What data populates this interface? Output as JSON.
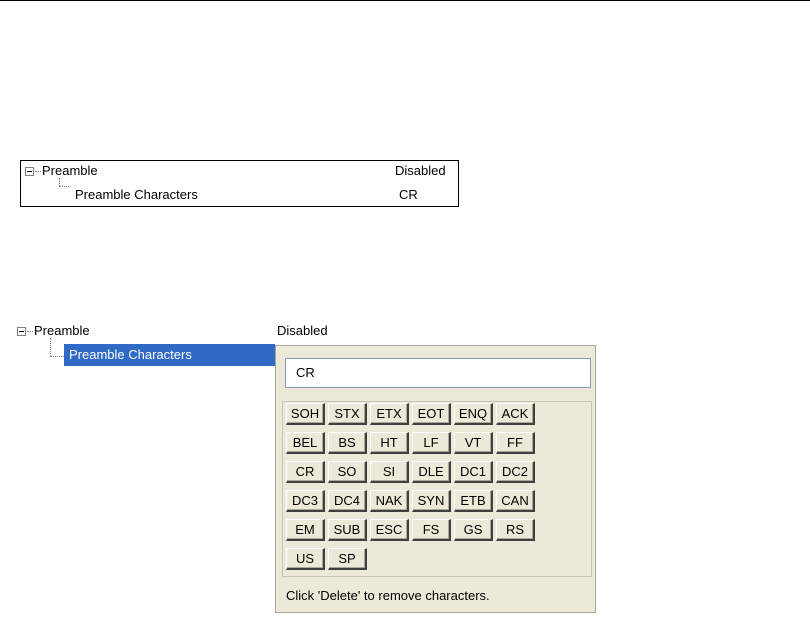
{
  "tree1": {
    "group_label": "Preamble",
    "group_value": "Disabled",
    "child_label": "Preamble Characters",
    "child_value": "CR"
  },
  "tree2": {
    "group_label": "Preamble",
    "group_value": "Disabled",
    "child_label": "Preamble Characters"
  },
  "editor": {
    "input_value": "CR",
    "keys": [
      "SOH",
      "STX",
      "ETX",
      "EOT",
      "ENQ",
      "ACK",
      "BEL",
      "BS",
      "HT",
      "LF",
      "VT",
      "FF",
      "CR",
      "SO",
      "SI",
      "DLE",
      "DC1",
      "DC2",
      "DC3",
      "DC4",
      "NAK",
      "SYN",
      "ETB",
      "CAN",
      "EM",
      "SUB",
      "ESC",
      "FS",
      "GS",
      "RS",
      "US",
      "SP"
    ],
    "hint": "Click 'Delete' to remove characters."
  },
  "colors": {
    "selection": "#316ac5",
    "panel_bg": "#ece9d8",
    "input_border": "#7f9db9"
  }
}
